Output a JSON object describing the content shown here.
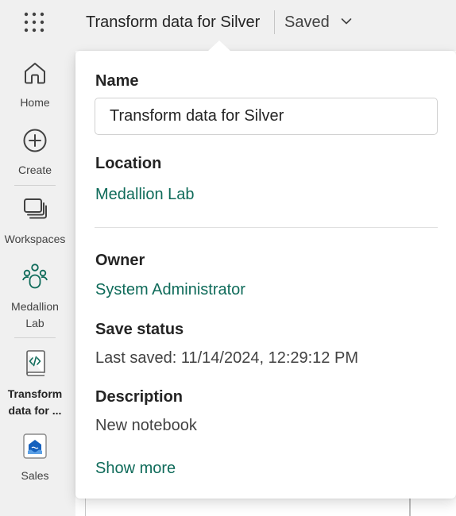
{
  "header": {
    "waffle_icon": "app-launcher-grid-icon",
    "title": "Transform data for Silver",
    "status": "Saved",
    "chevron_icon": "chevron-down-icon"
  },
  "nav": {
    "items": [
      {
        "label": "Home",
        "icon": "home-icon"
      },
      {
        "label": "Create",
        "icon": "plus-circle-icon"
      },
      {
        "label": "Workspaces",
        "icon": "workspaces-icon"
      },
      {
        "label": "Medallion Lab",
        "icon": "people-group-icon"
      },
      {
        "label": "Transform data for ...",
        "icon": "notebook-icon"
      },
      {
        "label": "Sales",
        "icon": "lakehouse-icon"
      }
    ]
  },
  "details": {
    "name_label": "Name",
    "name_value": "Transform data for Silver",
    "location_label": "Location",
    "location_value": "Medallion Lab",
    "owner_label": "Owner",
    "owner_value": "System Administrator",
    "save_status_label": "Save status",
    "save_status_value": "Last saved: 11/14/2024, 12:29:12 PM",
    "description_label": "Description",
    "description_value": "New notebook",
    "show_more": "Show more"
  },
  "colors": {
    "accent": "#0f6b5a",
    "background": "#f0f0f0",
    "panel": "#ffffff"
  }
}
